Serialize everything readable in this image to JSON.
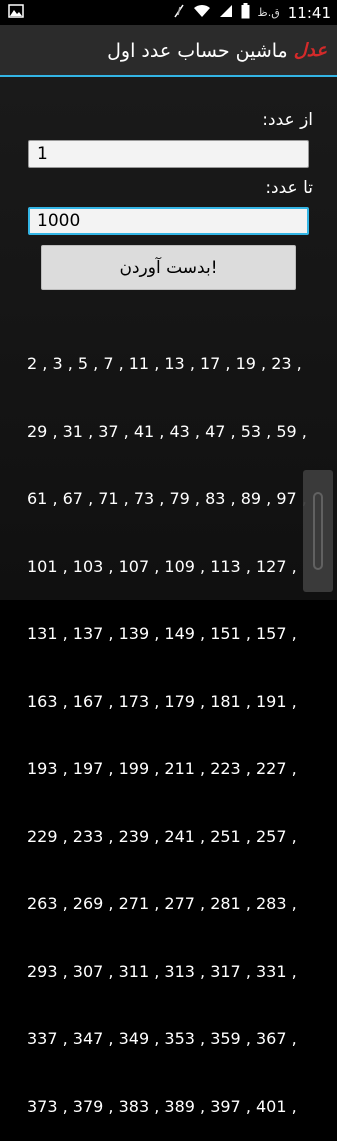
{
  "statusbar": {
    "time": "11:41",
    "ampm": "ق.ظ"
  },
  "appbar": {
    "title": "ماشین حساب عدد اول",
    "logo_text": "عدل"
  },
  "form": {
    "from_label": "از عدد:",
    "from_value": "1",
    "to_label": "تا عدد:",
    "to_value": "1000",
    "button_label": "بدست آوردن!"
  },
  "results": {
    "lines": [
      "2 , 3 , 5 , 7 , 11 , 13 , 17 , 19 , 23 ,",
      "29 , 31 , 37 , 41 , 43 , 47 , 53 , 59 ,",
      "61 , 67 , 71 , 73 , 79 , 83 , 89 , 97 ,",
      "101 , 103 , 107 , 109 , 113 , 127 ,",
      "131 , 137 , 139 , 149 , 151 , 157 ,",
      "163 , 167 , 173 , 179 , 181 , 191 ,",
      "193 , 197 , 199 , 211 , 223 , 227 ,",
      "229 , 233 , 239 , 241 , 251 , 257 ,",
      "263 , 269 , 271 , 277 , 281 , 283 ,",
      "293 , 307 , 311 , 313 , 317 , 331 ,",
      "337 , 347 , 349 , 353 , 359 , 367 ,",
      "373 , 379 , 383 , 389 , 397 , 401 ,"
    ]
  },
  "icons": {
    "gallery": "image-icon",
    "signal_off": "signal-off-icon",
    "wifi": "wifi-icon",
    "cell": "cell-signal-icon",
    "battery": "battery-icon"
  },
  "colors": {
    "accent": "#33b5e5",
    "logo": "#d42a2a",
    "appbar": "#2b2b2b"
  }
}
